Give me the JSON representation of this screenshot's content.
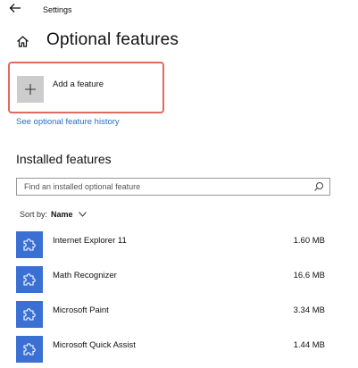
{
  "window": {
    "title": "Settings"
  },
  "page": {
    "title": "Optional features"
  },
  "add_feature": {
    "label": "Add a feature"
  },
  "history_link": {
    "label": "See optional feature history"
  },
  "installed": {
    "title": "Installed features",
    "search_placeholder": "Find an installed optional feature",
    "sort_label": "Sort by:",
    "sort_value": "Name",
    "items": [
      {
        "name": "Internet Explorer 11",
        "size": "1.60 MB",
        "icon": "puzzle-icon"
      },
      {
        "name": "Math Recognizer",
        "size": "16.6 MB",
        "icon": "puzzle-icon"
      },
      {
        "name": "Microsoft Paint",
        "size": "3.34 MB",
        "icon": "puzzle-icon"
      },
      {
        "name": "Microsoft Quick Assist",
        "size": "1.44 MB",
        "icon": "puzzle-icon"
      }
    ]
  },
  "colors": {
    "accent": "#3a6fd4",
    "link": "#2a6fbf",
    "highlight": "#e06a5f",
    "tile_gray": "#cccccc"
  }
}
